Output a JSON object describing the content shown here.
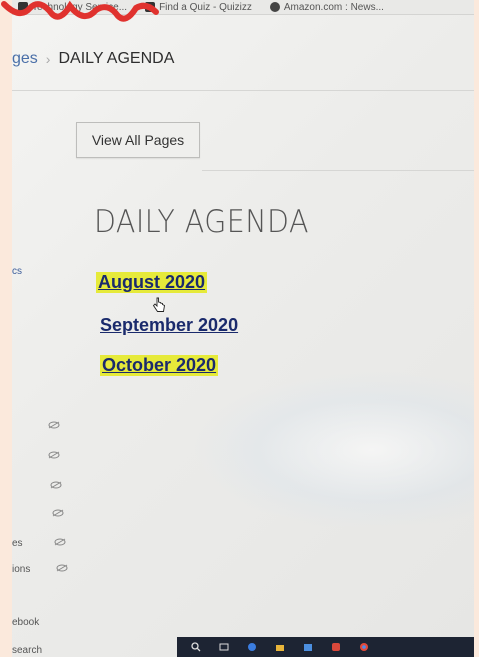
{
  "bookmarks": [
    {
      "label": "Technology Service...",
      "icon": "page-icon"
    },
    {
      "label": "Find a Quiz - Quizizz",
      "icon": "quizizz-icon"
    },
    {
      "label": "Amazon.com : News...",
      "icon": "amazon-icon"
    }
  ],
  "breadcrumb": {
    "parent": "ges",
    "separator": "›",
    "current": "DAILY AGENDA"
  },
  "view_all_button": "View All Pages",
  "page_title": "DAILY AGENDA",
  "agenda_links": [
    {
      "label": "August 2020",
      "highlighted": true
    },
    {
      "label": "September 2020",
      "highlighted": false
    },
    {
      "label": "October 2020",
      "highlighted": true
    }
  ],
  "sidebar": {
    "frag_1": "cs",
    "frag_2": "es",
    "frag_3": "ions",
    "frag_4": "ebook",
    "frag_5": "search"
  },
  "colors": {
    "highlight": "#e6ea3a",
    "link": "#1a2a6c",
    "scribble": "#e0322e",
    "taskbar": "#1d2433"
  }
}
